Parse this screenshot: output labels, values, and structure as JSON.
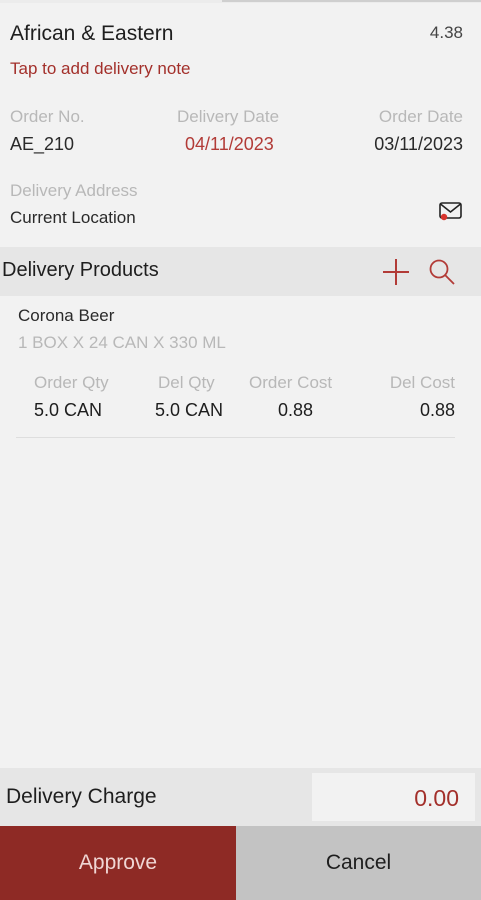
{
  "header": {
    "customer_name": "African & Eastern",
    "total": "4.38",
    "delivery_note_link": "Tap to add delivery note"
  },
  "order": {
    "order_no_label": "Order No.",
    "order_no": "AE_210",
    "delivery_date_label": "Delivery Date",
    "delivery_date": "04/11/2023",
    "order_date_label": "Order Date",
    "order_date": "03/11/2023",
    "address_label": "Delivery Address",
    "address": "Current Location",
    "icons": {
      "message": "envelope-icon"
    }
  },
  "products_section": {
    "title": "Delivery Products",
    "icons": {
      "add": "plus-icon",
      "search": "search-icon"
    },
    "items": [
      {
        "name": "Corona Beer",
        "pack": "1 BOX X 24 CAN X 330 ML",
        "order_qty_label": "Order Qty",
        "order_qty": "5.0 CAN",
        "del_qty_label": "Del Qty",
        "del_qty": "5.0 CAN",
        "order_cost_label": "Order Cost",
        "order_cost": "0.88",
        "del_cost_label": "Del Cost",
        "del_cost": "0.88"
      }
    ]
  },
  "footer": {
    "charge_label": "Delivery Charge",
    "charge_value": "0.00",
    "approve_label": "Approve",
    "cancel_label": "Cancel"
  },
  "colors": {
    "accent": "#a3302b",
    "approve_bg": "#8e2a25",
    "cancel_bg": "#c3c3c3",
    "section_bg": "#e6e6e6"
  }
}
